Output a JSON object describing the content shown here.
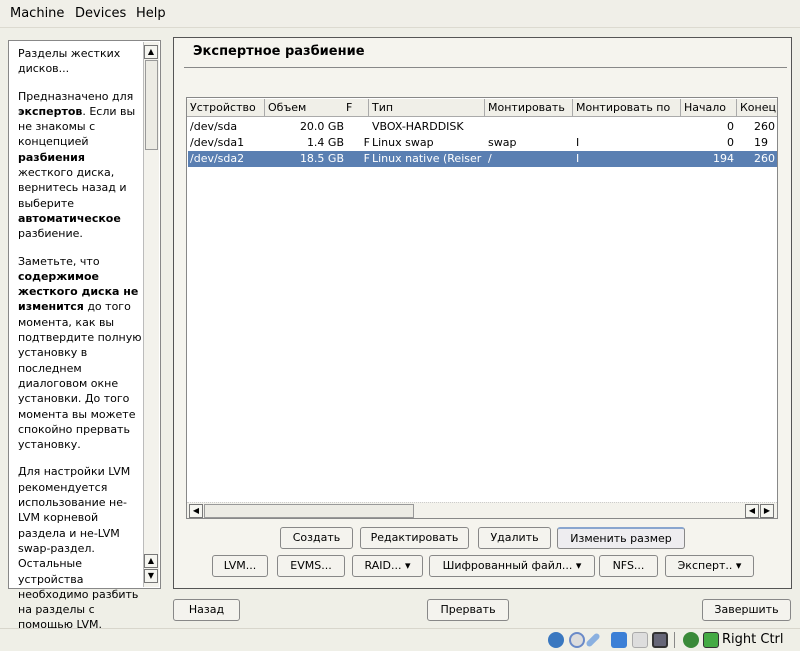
{
  "menu": [
    "Machine",
    "Devices",
    "Help"
  ],
  "help": [
    [
      {
        "t": "Разделы жестких дисков..."
      }
    ],
    [
      {
        "t": "Предназначено для "
      },
      {
        "t": "экспертов",
        "b": true
      },
      {
        "t": ". Если вы не знакомы с концепцией "
      },
      {
        "t": "разбиения",
        "b": true
      },
      {
        "t": " жесткого диска, вернитесь назад и выберите "
      },
      {
        "t": "автоматическое",
        "b": true
      },
      {
        "t": " разбиение."
      }
    ],
    [
      {
        "t": "Заметьте, что "
      },
      {
        "t": "содержимое жесткого диска не изменится",
        "b": true
      },
      {
        "t": " до того момента, как вы подтвердите полную установку в последнем диалоговом окне установки. До того момента вы можете спокойно прервать установку."
      }
    ],
    [
      {
        "t": "Для настройки LVM рекомендуется использование не-LVM корневой раздела и не-LVM swap-раздел. Остальные устройства необходимо разбить на разделы с помощью LVM."
      }
    ]
  ],
  "title": "Экспертное разбиение",
  "columns": [
    "Устройство",
    "Объем",
    "F",
    "Тип",
    "Монтировать",
    "Монтировать по",
    "Начало",
    "Конец"
  ],
  "rows": [
    [
      "/dev/sda",
      "20.0 GB",
      "",
      "VBOX-HARDDISK",
      "",
      "",
      "0",
      "260"
    ],
    [
      "/dev/sda1",
      "1.4 GB",
      "F",
      "Linux swap",
      "swap",
      "I",
      "0",
      "19"
    ],
    [
      "/dev/sda2",
      "18.5 GB",
      "F",
      "Linux native (Reiser)",
      "/",
      "I",
      "194",
      "260"
    ]
  ],
  "selected_row": 2,
  "buttons1": [
    "Создать",
    "Редактировать",
    "Удалить",
    "Изменить размер"
  ],
  "buttons2": [
    "LVM...",
    "EVMS...",
    "RAID... ▾",
    "Шифрованный файл... ▾",
    "NFS...",
    "Эксперт.. ▾"
  ],
  "nav": {
    "back": "Назад",
    "abort": "Прервать",
    "finish": "Завершить"
  },
  "status": {
    "host_key": "Right Ctrl"
  }
}
